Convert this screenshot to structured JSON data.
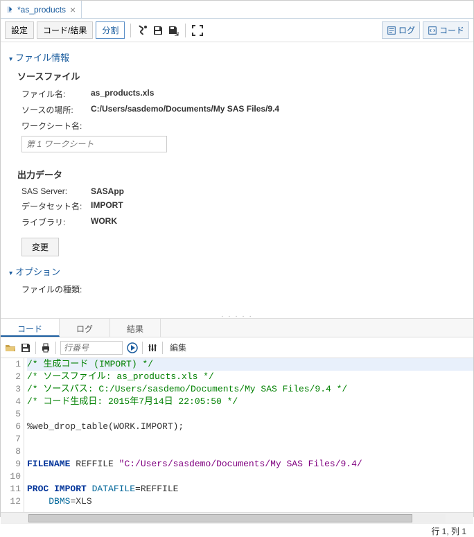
{
  "tab": {
    "title": "*as_products"
  },
  "toolbar": {
    "settings": "設定",
    "codeResults": "コード/結果",
    "split": "分割",
    "log": "ログ",
    "code": "コード"
  },
  "sections": {
    "fileInfo": "ファイル情報",
    "options": "オプション"
  },
  "sourceFile": {
    "title": "ソースファイル",
    "fileNameLabel": "ファイル名:",
    "fileName": "as_products.xls",
    "sourceLocLabel": "ソースの場所:",
    "sourceLoc": "C:/Users/sasdemo/Documents/My SAS Files/9.4",
    "worksheetLabel": "ワークシート名:",
    "worksheetPlaceholder": "第 1 ワークシート"
  },
  "outputData": {
    "title": "出力データ",
    "serverLabel": "SAS Server:",
    "server": "SASApp",
    "datasetLabel": "データセット名:",
    "dataset": "IMPORT",
    "libraryLabel": "ライブラリ:",
    "library": "WORK",
    "changeBtn": "変更"
  },
  "fileTypeLabel": "ファイルの種類:",
  "lowerTabs": {
    "code": "コード",
    "log": "ログ",
    "results": "結果"
  },
  "codeToolbar": {
    "linePlaceholder": "行番号",
    "edit": "編集"
  },
  "code": {
    "l1": "/* 生成コード (IMPORT) */",
    "l2": "/* ソースファイル: as_products.xls */",
    "l3": "/* ソースパス: C:/Users/sasdemo/Documents/My SAS Files/9.4 */",
    "l4": "/* コード生成日: 2015年7月14日 22:05:50 */",
    "l5": "",
    "l6": "%web_drop_table(WORK.IMPORT);",
    "l7": "",
    "l8": "",
    "l9a": "FILENAME",
    "l9b": " REFFILE ",
    "l9c": "\"C:/Users/sasdemo/Documents/My SAS Files/9.4/",
    "l10": "",
    "l11a": "PROC IMPORT",
    "l11b": " DATAFILE",
    "l11c": "=REFFILE",
    "l12a": "DBMS",
    "l12b": "=XLS"
  },
  "status": "行 1, 列 1"
}
